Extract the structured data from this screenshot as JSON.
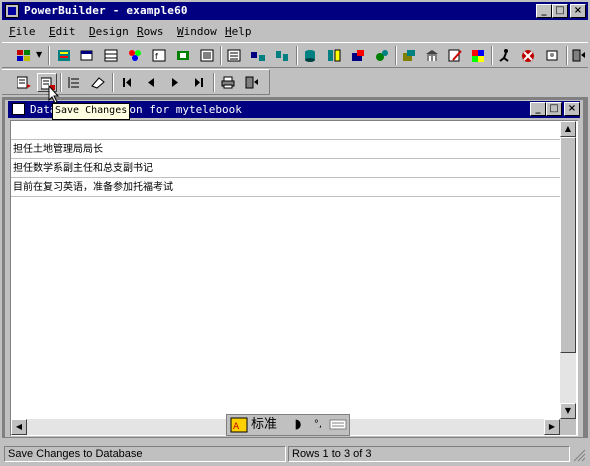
{
  "app": {
    "title": "PowerBuilder - example60"
  },
  "menu": [
    "File",
    "Edit",
    "Design",
    "Rows",
    "Window",
    "Help"
  ],
  "toolbar1": [
    "new-icon",
    "library-icon",
    "window-icon",
    "structure-icon",
    "menu-icon",
    "function-icon",
    "user-object-icon",
    "application-icon",
    "datawindow-icon",
    "query-icon",
    "pipeline-icon",
    "database-icon",
    "database-profile-icon",
    "database-admin-icon",
    "project-icon",
    "browser-icon",
    "library-painter-icon",
    "editor-icon",
    "color-icon",
    "run-icon",
    "debug-icon",
    "exit-icon"
  ],
  "toolbar2": [
    "insert-row-icon",
    "save-changes-icon",
    "row-icon",
    "eraser-icon",
    "first-icon",
    "prior-icon",
    "next-icon",
    "last-icon",
    "print-icon",
    "close-icon"
  ],
  "tooltip": {
    "text": "Save Changes"
  },
  "child": {
    "title": "Data Manipulation for mytelebook"
  },
  "rows": [
    {
      "text": ""
    },
    {
      "text": "担任土地管理局局长"
    },
    {
      "text": "担任数学系副主任和总支副书记"
    },
    {
      "text": "目前在复习英语，准备参加托福考试"
    }
  ],
  "ime": {
    "label": "标准"
  },
  "status": {
    "message": "Save Changes to Database",
    "rows": "Rows 1 to 3 of 3"
  }
}
